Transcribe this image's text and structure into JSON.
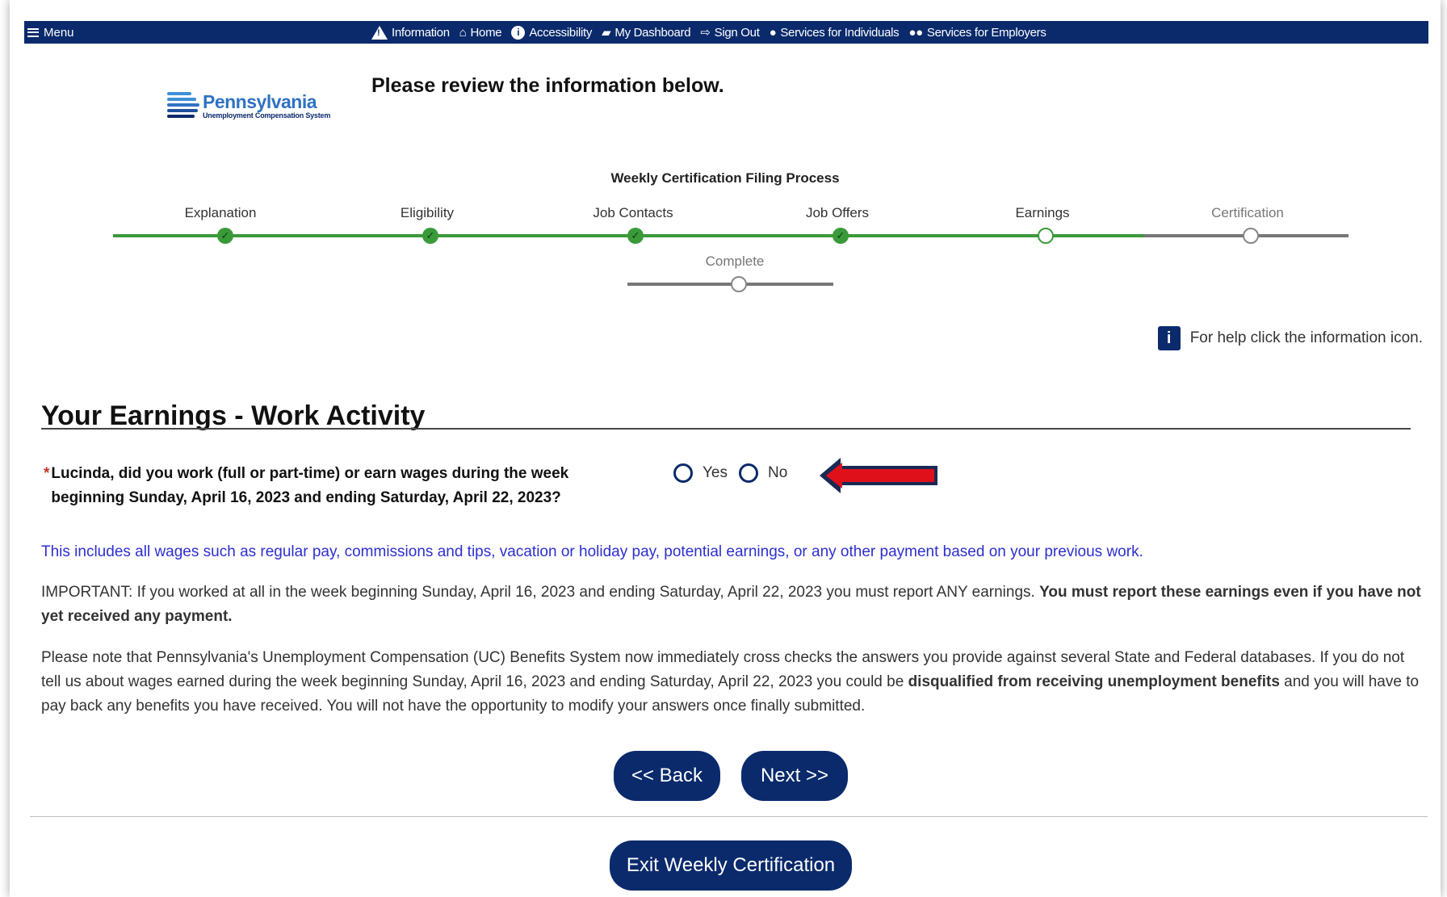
{
  "nav": {
    "menu_label": "Menu",
    "links": [
      {
        "label": "Information",
        "icon": "warning-icon"
      },
      {
        "label": "Home",
        "icon": "home-icon"
      },
      {
        "label": "Accessibility",
        "icon": "info-circle-icon"
      },
      {
        "label": "My Dashboard",
        "icon": "dashboard-icon"
      },
      {
        "label": "Sign Out",
        "icon": "sign-out-icon"
      },
      {
        "label": "Services for Individuals",
        "icon": "person-icon"
      },
      {
        "label": "Services for Employers",
        "icon": "group-icon"
      }
    ]
  },
  "logo": {
    "name": "Pennsylvania",
    "subtitle": "Unemployment Compensation System"
  },
  "page_title": "Please review the information below.",
  "stepper": {
    "title": "Weekly Certification Filing Process",
    "steps": [
      {
        "label": "Explanation",
        "state": "done"
      },
      {
        "label": "Eligibility",
        "state": "done"
      },
      {
        "label": "Job Contacts",
        "state": "done"
      },
      {
        "label": "Job Offers",
        "state": "done"
      },
      {
        "label": "Earnings",
        "state": "current"
      },
      {
        "label": "Certification",
        "state": "pending"
      },
      {
        "label": "Complete",
        "state": "pending"
      }
    ]
  },
  "help_text": "For help click the information icon.",
  "section_title": "Your Earnings - Work Activity",
  "question": {
    "required_mark": "*",
    "text": "Lucinda, did you work (full or part-time) or earn wages during the week beginning Sunday, April 16, 2023 and ending Saturday, April 22, 2023?",
    "options": [
      "Yes",
      "No"
    ]
  },
  "info_text": "This includes all wages such as regular pay, commissions and tips, vacation or holiday pay, potential earnings, or any other payment based on your previous work.",
  "important": {
    "normal": "IMPORTANT: If you worked at all in the week beginning Sunday, April 16, 2023 and ending Saturday, April 22, 2023 you must report ANY earnings. ",
    "bold": "You must report these earnings even if you have not yet received any payment."
  },
  "note": {
    "part1": "Please note that Pennsylvania's Unemployment Compensation (UC) Benefits System now immediately cross checks the answers you provide against several State and Federal databases. If you do not tell us about wages earned during the week beginning Sunday, April 16, 2023 and ending Saturday, April 22, 2023 you could be ",
    "bold": "disqualified from receiving unemployment benefits",
    "part2": " and you will have to pay back any benefits you have received. You will not have the opportunity to modify your answers once finally submitted."
  },
  "buttons": {
    "back": "<< Back",
    "next": "Next >>",
    "exit": "Exit Weekly Certification"
  },
  "colors": {
    "navy": "#0a2a6c",
    "progress_green": "#3a9a3a",
    "info_blue": "#2d2fd0",
    "arrow_red": "#e0101a"
  }
}
